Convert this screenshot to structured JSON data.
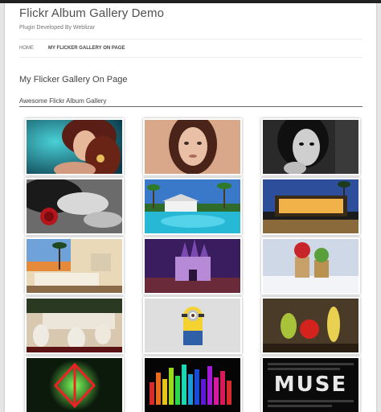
{
  "site": {
    "title": "Flickr Album Gallery Demo",
    "description": "Plugin Developed By Weblizar"
  },
  "nav": {
    "items": [
      {
        "label": "HOME",
        "current": false
      },
      {
        "label": "MY FLICKER GALLERY ON PAGE",
        "current": true
      }
    ]
  },
  "page": {
    "heading": "My Flicker Gallery On Page",
    "gallery_title": "Awesome Flickr Album Gallery"
  },
  "gallery": {
    "items": [
      {
        "icon": "woman-teal-photo"
      },
      {
        "icon": "woman-portrait-photo"
      },
      {
        "icon": "woman-bw-photo"
      },
      {
        "icon": "woman-red-rose-photo"
      },
      {
        "icon": "resort-pool-photo"
      },
      {
        "icon": "house-night-photo"
      },
      {
        "icon": "living-room-photo"
      },
      {
        "icon": "castle-night-photo"
      },
      {
        "icon": "cupcake-figures-photo"
      },
      {
        "icon": "pug-dogs-photo"
      },
      {
        "icon": "minion-photo"
      },
      {
        "icon": "fruit-characters-photo"
      },
      {
        "icon": "green-logo-photo"
      },
      {
        "icon": "equalizer-bars-photo"
      },
      {
        "icon": "muse-typography-photo"
      }
    ],
    "muse_text": "MUSE"
  },
  "colors": {
    "page_bg": "#e6e6e6",
    "content_bg": "#ffffff",
    "topbar": "#222222"
  }
}
